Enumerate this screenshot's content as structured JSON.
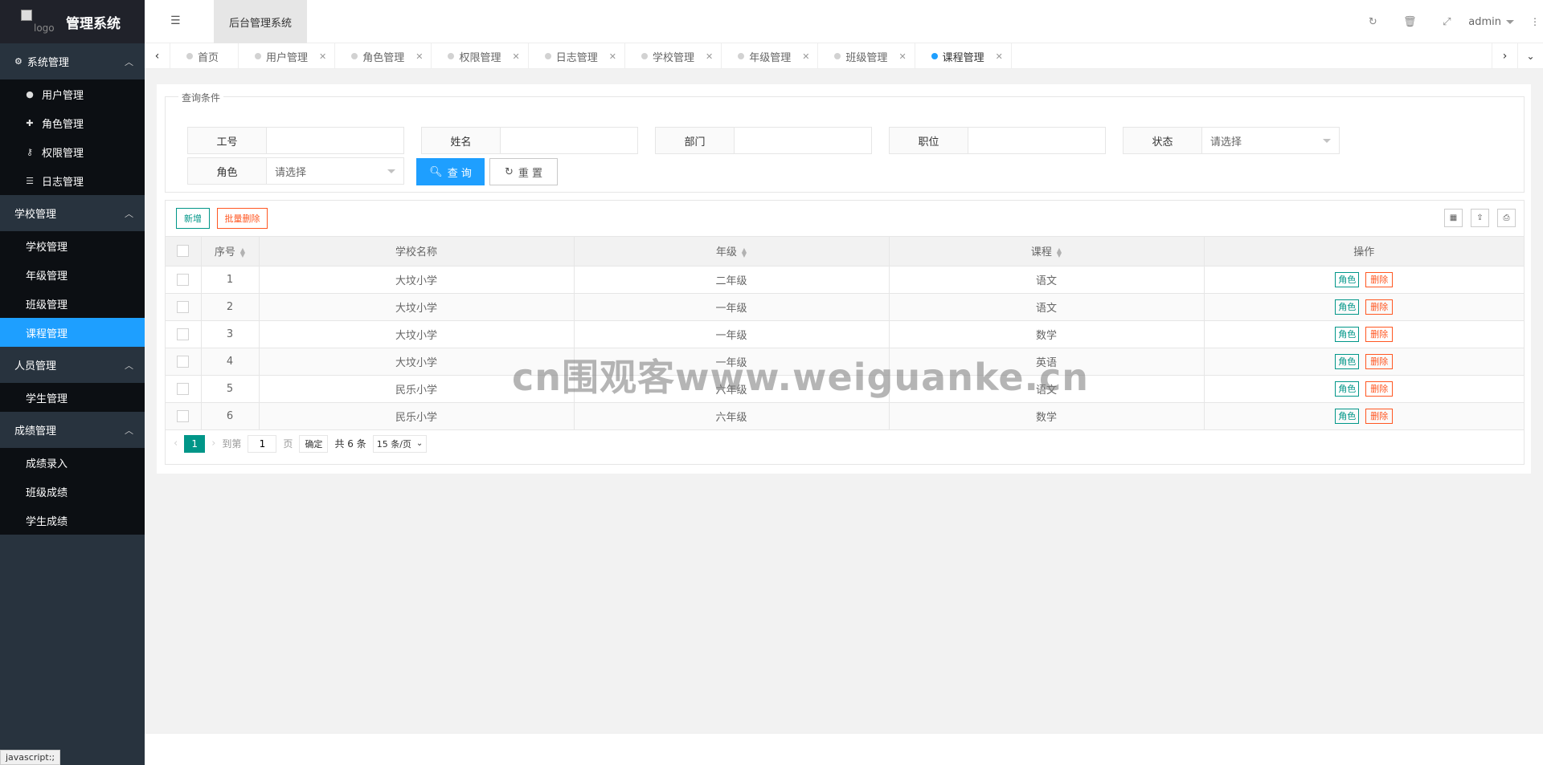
{
  "app": {
    "title": "管理系统",
    "logo_alt": "logo"
  },
  "header": {
    "active_tab": "后台管理系统",
    "user": "admin",
    "icons": [
      "refresh-icon",
      "trash-icon",
      "fullscreen-icon"
    ]
  },
  "sidebar": {
    "groups": [
      {
        "label": "系统管理",
        "items": [
          "用户管理",
          "角色管理",
          "权限管理",
          "日志管理"
        ]
      },
      {
        "label": "学校管理",
        "items": [
          "学校管理",
          "年级管理",
          "班级管理",
          "课程管理"
        ]
      },
      {
        "label": "人员管理",
        "items": [
          "学生管理"
        ]
      },
      {
        "label": "成绩管理",
        "items": [
          "成绩录入",
          "班级成绩",
          "学生成绩"
        ]
      }
    ],
    "active_item": "课程管理"
  },
  "tabs": [
    "首页",
    "用户管理",
    "角色管理",
    "权限管理",
    "日志管理",
    "学校管理",
    "年级管理",
    "班级管理",
    "课程管理"
  ],
  "search": {
    "legend": "查询条件",
    "fields": {
      "job_no": "工号",
      "name": "姓名",
      "dept": "部门",
      "position": "职位",
      "status": "状态",
      "role": "角色"
    },
    "select_placeholder": "请选择",
    "query_btn": "查 询",
    "reset_btn": "重 置"
  },
  "toolbar": {
    "add": "新增",
    "batch_delete": "批量删除"
  },
  "table": {
    "headers": [
      "序号",
      "学校名称",
      "年级",
      "课程",
      "操作"
    ],
    "rows": [
      {
        "no": "1",
        "school": "大坟小学",
        "grade": "二年级",
        "course": "语文"
      },
      {
        "no": "2",
        "school": "大坟小学",
        "grade": "一年级",
        "course": "语文"
      },
      {
        "no": "3",
        "school": "大坟小学",
        "grade": "一年级",
        "course": "数学"
      },
      {
        "no": "4",
        "school": "大坟小学",
        "grade": "一年级",
        "course": "英语"
      },
      {
        "no": "5",
        "school": "民乐小学",
        "grade": "六年级",
        "course": "语文"
      },
      {
        "no": "6",
        "school": "民乐小学",
        "grade": "六年级",
        "course": "数学"
      }
    ],
    "op_role": "角色",
    "op_delete": "删除"
  },
  "pager": {
    "current": "1",
    "goto_label": "到第",
    "page_input": "1",
    "page_unit": "页",
    "ok": "确定",
    "total": "共 6 条",
    "size": "15 条/页"
  },
  "watermark": "cn围观客www.weiguanke.cn",
  "status_link": "javascript:;"
}
